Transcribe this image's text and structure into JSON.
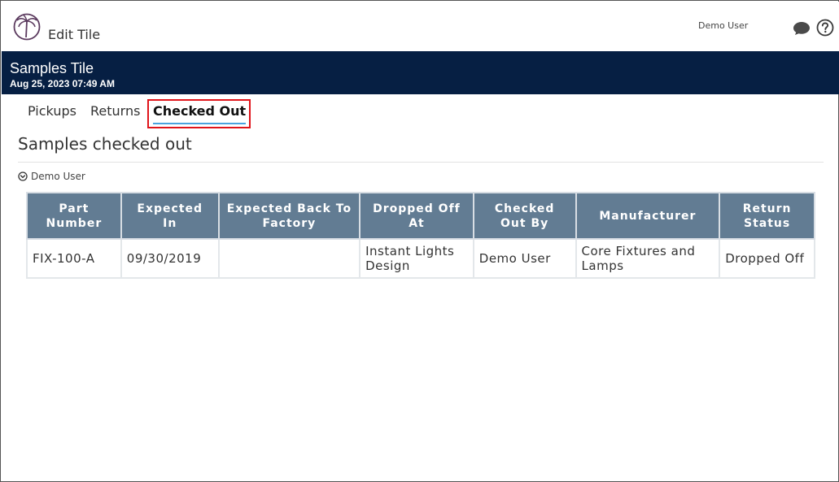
{
  "header": {
    "title": "Edit Tile",
    "user_name": "Demo User",
    "logo_icon": "palm-tree-logo",
    "chat_icon": "chat-bubble-icon",
    "help_icon": "help-icon"
  },
  "banner": {
    "title": "Samples Tile",
    "date": "Aug 25, 2023 07:49 AM",
    "background": "#061f43"
  },
  "tabs": {
    "items": [
      {
        "label": "Pickups",
        "active": false
      },
      {
        "label": "Returns",
        "active": false
      },
      {
        "label": "Checked Out",
        "active": true
      }
    ],
    "highlight_color": "#e0141a",
    "underline_color": "#4aa3df"
  },
  "section": {
    "title": "Samples checked out",
    "group_label": "Demo User",
    "group_icon": "chevron-circle-down-icon"
  },
  "table": {
    "header_color": "#627c93",
    "columns": [
      "Part Number",
      "Expected In",
      "Expected Back To Factory",
      "Dropped Off At",
      "Checked Out By",
      "Manufacturer",
      "Return Status"
    ],
    "rows": [
      [
        "FIX-100-A",
        "09/30/2019",
        "",
        "Instant Lights Design",
        "Demo User",
        "Core Fixtures and Lamps",
        "Dropped Off"
      ]
    ]
  }
}
